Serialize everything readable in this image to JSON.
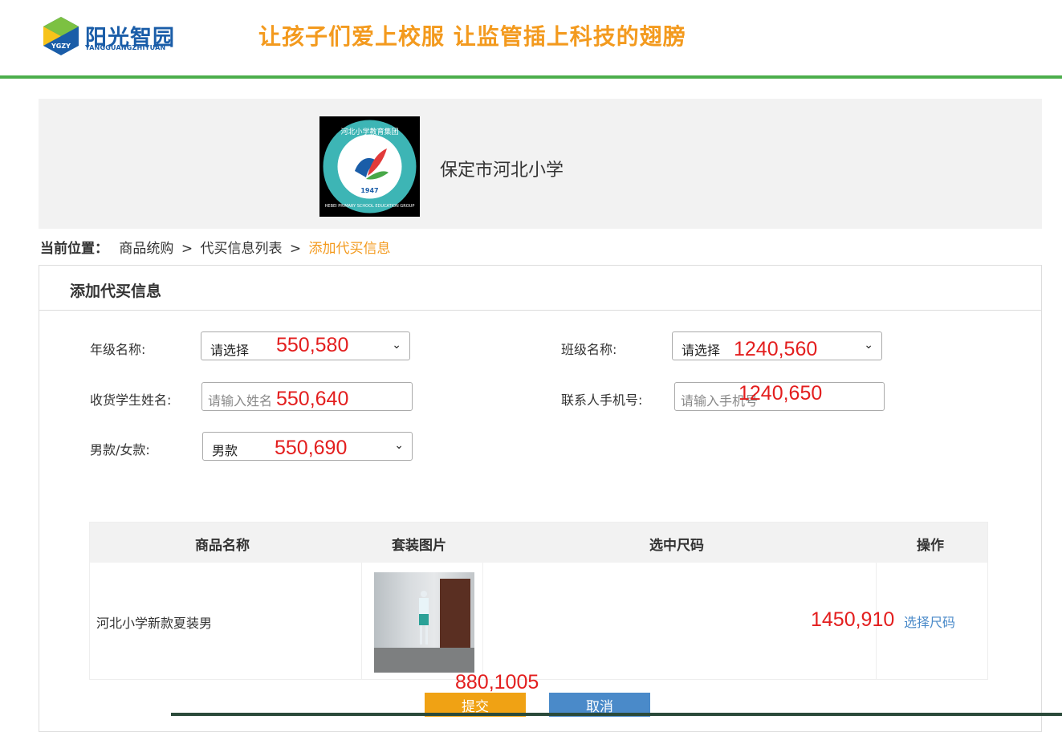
{
  "header": {
    "logo_text": "阳光智园",
    "logo_sub": "YANGGUANGZHIYUAN",
    "logo_badge": "YGZY",
    "slogan": "让孩子们爱上校服  让监管插上科技的翅膀",
    "accent_color": "#4cae4c",
    "slogan_color": "#f39a1e"
  },
  "school": {
    "name": "保定市河北小学",
    "logo_ring_text": "河北小学教育集团",
    "logo_sub_text": "HEBEI PRIMARY SCHOOL EDUCATION GROUP",
    "logo_year": "1947"
  },
  "breadcrumb": {
    "label": "当前位置：",
    "items": [
      "商品统购",
      "代买信息列表"
    ],
    "separator": ">",
    "current": "添加代买信息"
  },
  "form": {
    "title": "添加代买信息",
    "grade_label": "年级名称:",
    "grade_value": "请选择",
    "class_label": "班级名称:",
    "class_value": "请选择",
    "name_label": "收货学生姓名:",
    "name_placeholder": "请输入姓名",
    "phone_label": "联系人手机号:",
    "phone_placeholder": "请输入手机号",
    "gender_label": "男款/女款:",
    "gender_value": "男款"
  },
  "table": {
    "headers": [
      "商品名称",
      "套装图片",
      "选中尺码",
      "操作"
    ],
    "rows": [
      {
        "name": "河北小学新款夏装男",
        "size": "",
        "action": "选择尺码"
      }
    ]
  },
  "actions": {
    "submit": "提交",
    "cancel": "取消"
  },
  "overlay_labels": [
    "550,580",
    "1240,560",
    "550,640",
    "1240,650",
    "550,690",
    "1450,910",
    "880,1005"
  ]
}
